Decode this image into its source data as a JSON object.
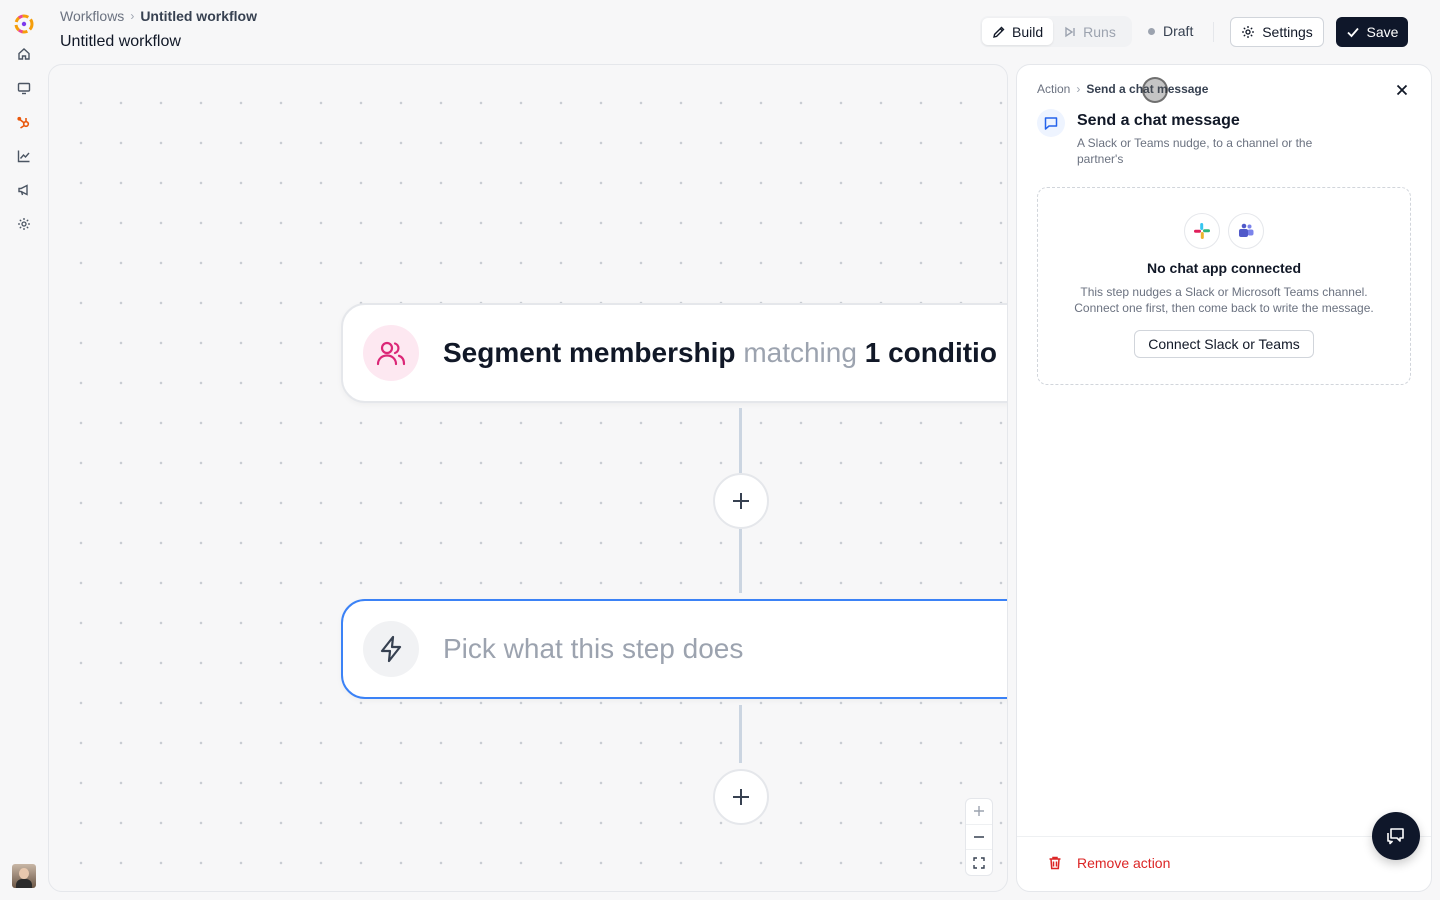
{
  "header": {
    "breadcrumb_root": "Workflows",
    "breadcrumb_current": "Untitled workflow",
    "title": "Untitled workflow",
    "tabs": {
      "build": "Build",
      "runs": "Runs"
    },
    "status": "Draft",
    "settings_label": "Settings",
    "save_label": "Save"
  },
  "sidebar": {
    "items": [
      "home-icon",
      "monitor-icon",
      "hubspot-icon",
      "chart-icon",
      "megaphone-icon",
      "gear-icon"
    ]
  },
  "canvas": {
    "trigger": {
      "bold": "Segment membership",
      "muted": "matching",
      "count": "1 conditio"
    },
    "step_placeholder": "Pick what this step does"
  },
  "panel": {
    "crumb_root": "Action",
    "crumb_current": "Send a chat message",
    "title": "Send a chat message",
    "description": "A Slack or Teams nudge, to a channel or the partner's",
    "empty_title": "No chat app connected",
    "empty_desc_1": "This step nudges a Slack or Microsoft Teams channel.",
    "empty_desc_2": "Connect one first, then come back to write the message.",
    "connect_label": "Connect Slack or Teams",
    "remove_label": "Remove action"
  },
  "colors": {
    "accent": "#0f172a",
    "selected_border": "#3b82f6",
    "danger": "#dc2626",
    "trigger_icon": "#db2777"
  }
}
